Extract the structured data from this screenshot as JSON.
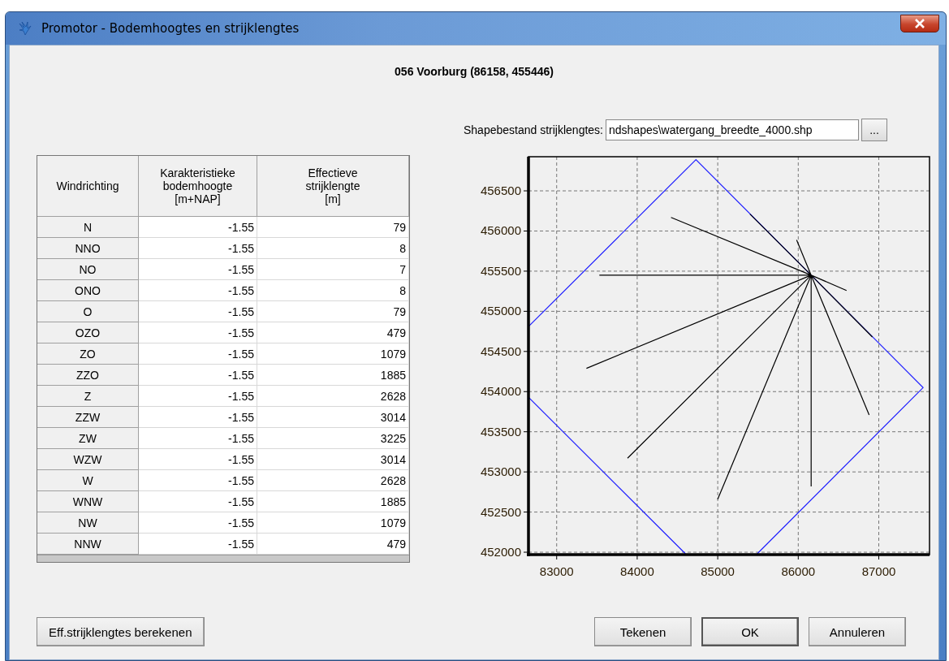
{
  "window": {
    "title": "Promotor - Bodemhoogtes en strijklengtes"
  },
  "heading": "056 Voorburg (86158, 455446)",
  "table": {
    "columns": [
      "Windrichting",
      "Karakteristieke\nbodemhoogte\n[m+NAP]",
      "Effectieve\nstrijklengte\n[m]"
    ],
    "rows": [
      {
        "direction": "N",
        "bed_level": "-1.55",
        "fetch": "79"
      },
      {
        "direction": "NNO",
        "bed_level": "-1.55",
        "fetch": "8"
      },
      {
        "direction": "NO",
        "bed_level": "-1.55",
        "fetch": "7"
      },
      {
        "direction": "ONO",
        "bed_level": "-1.55",
        "fetch": "8"
      },
      {
        "direction": "O",
        "bed_level": "-1.55",
        "fetch": "79"
      },
      {
        "direction": "OZO",
        "bed_level": "-1.55",
        "fetch": "479"
      },
      {
        "direction": "ZO",
        "bed_level": "-1.55",
        "fetch": "1079"
      },
      {
        "direction": "ZZO",
        "bed_level": "-1.55",
        "fetch": "1885"
      },
      {
        "direction": "Z",
        "bed_level": "-1.55",
        "fetch": "2628"
      },
      {
        "direction": "ZZW",
        "bed_level": "-1.55",
        "fetch": "3014"
      },
      {
        "direction": "ZW",
        "bed_level": "-1.55",
        "fetch": "3225"
      },
      {
        "direction": "WZW",
        "bed_level": "-1.55",
        "fetch": "3014"
      },
      {
        "direction": "W",
        "bed_level": "-1.55",
        "fetch": "2628"
      },
      {
        "direction": "WNW",
        "bed_level": "-1.55",
        "fetch": "1885"
      },
      {
        "direction": "NW",
        "bed_level": "-1.55",
        "fetch": "1079"
      },
      {
        "direction": "NNW",
        "bed_level": "-1.55",
        "fetch": "479"
      }
    ]
  },
  "shapefile": {
    "label": "Shapebestand strijklengtes:",
    "value": "ndshapes\\watergang_breedte_4000.shp",
    "browse": "..."
  },
  "chart_data": {
    "type": "line",
    "xlim": [
      82650,
      87630
    ],
    "ylim": [
      451970,
      456925
    ],
    "xticks": [
      83000,
      84000,
      85000,
      86000,
      87000
    ],
    "yticks": [
      452000,
      452500,
      453000,
      453500,
      454000,
      454500,
      455000,
      455500,
      456000,
      456500
    ],
    "grid": true,
    "series": [
      {
        "color": "#2020ff",
        "x": [
          82650,
          84730,
          87550,
          85490,
          null,
          84600,
          82650
        ],
        "values": [
          454810,
          456890,
          454050,
          451980,
          null,
          451980,
          453930
        ]
      },
      {
        "color": "#000000",
        "x": [
          86160,
          86600,
          null,
          86160,
          86920,
          null,
          86160,
          86880,
          null,
          86160,
          86160,
          null,
          86160,
          85000,
          null,
          86160,
          83880,
          null,
          86160,
          83370,
          null,
          86160,
          83530,
          null,
          86160,
          84420,
          null,
          86160,
          85400,
          null,
          86160,
          85980
        ],
        "values": [
          455450,
          455260,
          null,
          455450,
          454680,
          null,
          455450,
          453710,
          null,
          455450,
          452820,
          null,
          455450,
          452660,
          null,
          455450,
          453170,
          null,
          455450,
          454290,
          null,
          455450,
          455450,
          null,
          455450,
          456170,
          null,
          455450,
          456210,
          null,
          455450,
          455890
        ]
      }
    ]
  },
  "actions": {
    "left": [
      {
        "label": "Eff.strijklengtes berekenen",
        "default": false
      }
    ],
    "right": [
      {
        "label": "Tekenen",
        "default": false
      },
      {
        "label": "OK",
        "default": true
      },
      {
        "label": "Annuleren",
        "default": false
      }
    ]
  }
}
